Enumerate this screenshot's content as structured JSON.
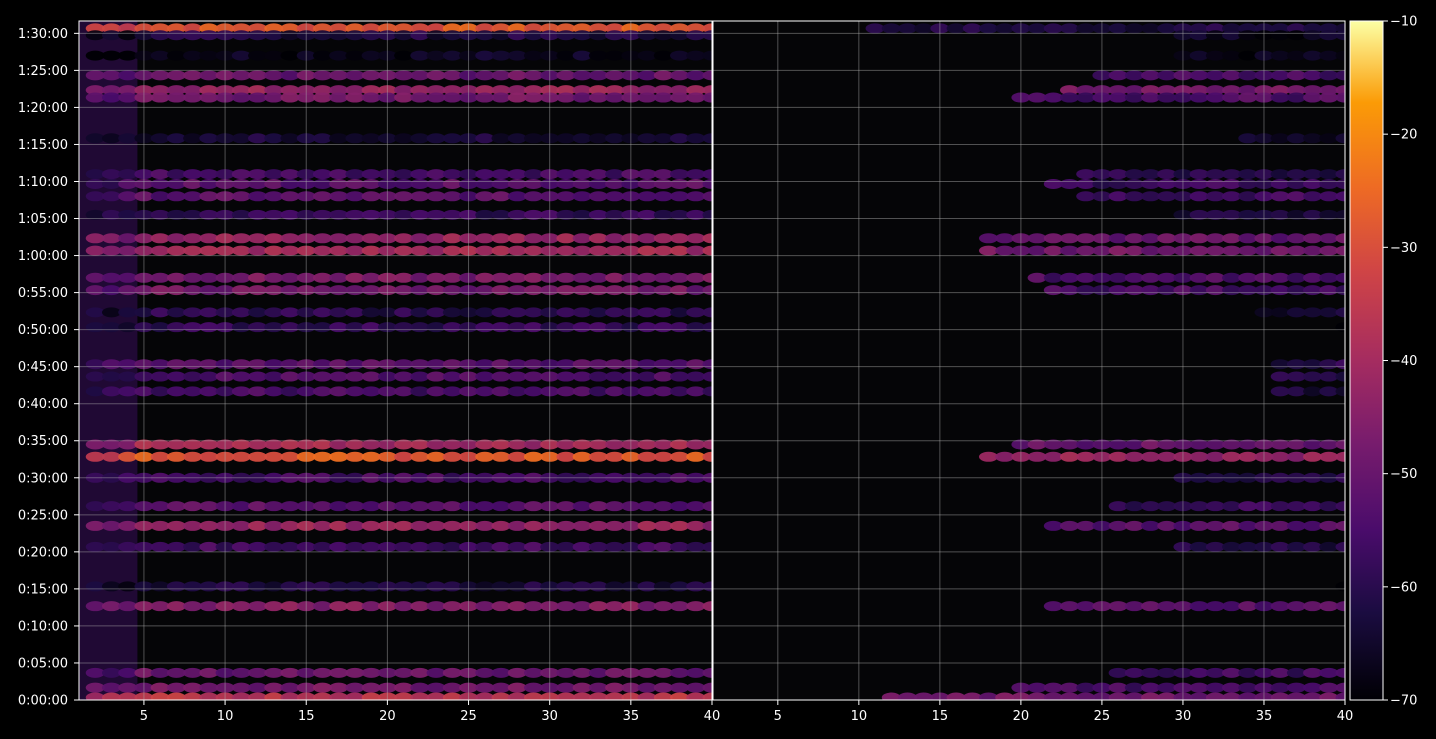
{
  "chart_data": {
    "type": "heatmap",
    "title": "",
    "colormap": "inferno",
    "background_color": "#000000",
    "axis_color": "#ffffff",
    "grid": true,
    "panels": [
      {
        "name": "left",
        "x_ticks": [
          5,
          10,
          15,
          20,
          25,
          30,
          35,
          40
        ],
        "xlim": [
          1,
          40
        ],
        "x_first_tick_label": ""
      },
      {
        "name": "right",
        "x_ticks": [
          40,
          5,
          10,
          15,
          20,
          25,
          30,
          35,
          40
        ],
        "xlim": [
          1,
          40
        ],
        "x_first_tick_label": "40"
      }
    ],
    "x_tick_labels_left": [
      "5",
      "10",
      "15",
      "20",
      "25",
      "30",
      "35",
      "40"
    ],
    "x_tick_labels_right": [
      "5",
      "10",
      "15",
      "20",
      "25",
      "30",
      "35",
      "40"
    ],
    "y_ticks_seconds": [
      0,
      300,
      600,
      900,
      1200,
      1500,
      1800,
      2100,
      2400,
      2700,
      3000,
      3300,
      3600,
      3900,
      4200,
      4500,
      4800,
      5100,
      5400
    ],
    "y_tick_labels": [
      "0:00:00",
      "0:05:00",
      "0:10:00",
      "0:15:00",
      "0:20:00",
      "0:25:00",
      "0:30:00",
      "0:35:00",
      "0:40:00",
      "0:45:00",
      "0:50:00",
      "0:55:00",
      "1:00:00",
      "1:05:00",
      "1:10:00",
      "1:15:00",
      "1:20:00",
      "1:25:00",
      "1:30:00"
    ],
    "ylim_seconds": [
      0,
      5500
    ],
    "colorbar": {
      "range": [
        -70,
        -10
      ],
      "ticks": [
        -10,
        -20,
        -30,
        -40,
        -50,
        -60,
        -70
      ],
      "tick_labels": [
        "−10",
        "−20",
        "−30",
        "−40",
        "−50",
        "−60",
        "−70"
      ]
    },
    "bands": [
      {
        "t": 5440,
        "left_level": -28,
        "right_level": -62,
        "right_from": 11
      },
      {
        "t": 5385,
        "left_level": -62,
        "right_level": -66,
        "right_from": 30
      },
      {
        "t": 5220,
        "left_level": -66,
        "right_level": -68,
        "right_from": 30
      },
      {
        "t": 5060,
        "left_level": -50,
        "right_level": -55,
        "right_from": 25
      },
      {
        "t": 4940,
        "left_level": -42,
        "right_level": -48,
        "right_from": 23
      },
      {
        "t": 4880,
        "left_level": -48,
        "right_level": -54,
        "right_from": 20
      },
      {
        "t": 4550,
        "left_level": -63,
        "right_level": -66,
        "right_from": 34
      },
      {
        "t": 4260,
        "left_level": -55,
        "right_level": -60,
        "right_from": 24
      },
      {
        "t": 4180,
        "left_level": -52,
        "right_level": -57,
        "right_from": 22
      },
      {
        "t": 4080,
        "left_level": -52,
        "right_level": -56,
        "right_from": 24
      },
      {
        "t": 3930,
        "left_level": -58,
        "right_level": -62,
        "right_from": 30
      },
      {
        "t": 3740,
        "left_level": -42,
        "right_level": -50,
        "right_from": 18
      },
      {
        "t": 3640,
        "left_level": -40,
        "right_level": -48,
        "right_from": 18
      },
      {
        "t": 3420,
        "left_level": -47,
        "right_level": -54,
        "right_from": 21
      },
      {
        "t": 3320,
        "left_level": -48,
        "right_level": -55,
        "right_from": 22
      },
      {
        "t": 3140,
        "left_level": -60,
        "right_level": -64,
        "right_from": 35
      },
      {
        "t": 3020,
        "left_level": -58,
        "right_level": -70,
        "right_from": 40
      },
      {
        "t": 2720,
        "left_level": -52,
        "right_level": -60,
        "right_from": 36
      },
      {
        "t": 2620,
        "left_level": -54,
        "right_level": -60,
        "right_from": 36
      },
      {
        "t": 2500,
        "left_level": -55,
        "right_level": -62,
        "right_from": 36
      },
      {
        "t": 2070,
        "left_level": -40,
        "right_level": -50,
        "right_from": 20
      },
      {
        "t": 1970,
        "left_level": -28,
        "right_level": -42,
        "right_from": 18
      },
      {
        "t": 1800,
        "left_level": -55,
        "right_level": -60,
        "right_from": 30
      },
      {
        "t": 1570,
        "left_level": -52,
        "right_level": -58,
        "right_from": 26
      },
      {
        "t": 1410,
        "left_level": -42,
        "right_level": -52,
        "right_from": 22
      },
      {
        "t": 1240,
        "left_level": -56,
        "right_level": -62,
        "right_from": 30
      },
      {
        "t": 920,
        "left_level": -62,
        "right_level": -70,
        "right_from": 40
      },
      {
        "t": 760,
        "left_level": -45,
        "right_level": -52,
        "right_from": 22
      },
      {
        "t": 220,
        "left_level": -50,
        "right_level": -56,
        "right_from": 26
      },
      {
        "t": 100,
        "left_level": -48,
        "right_level": -55,
        "right_from": 20
      },
      {
        "t": 20,
        "left_level": -36,
        "right_level": -48,
        "right_from": 12
      }
    ]
  }
}
